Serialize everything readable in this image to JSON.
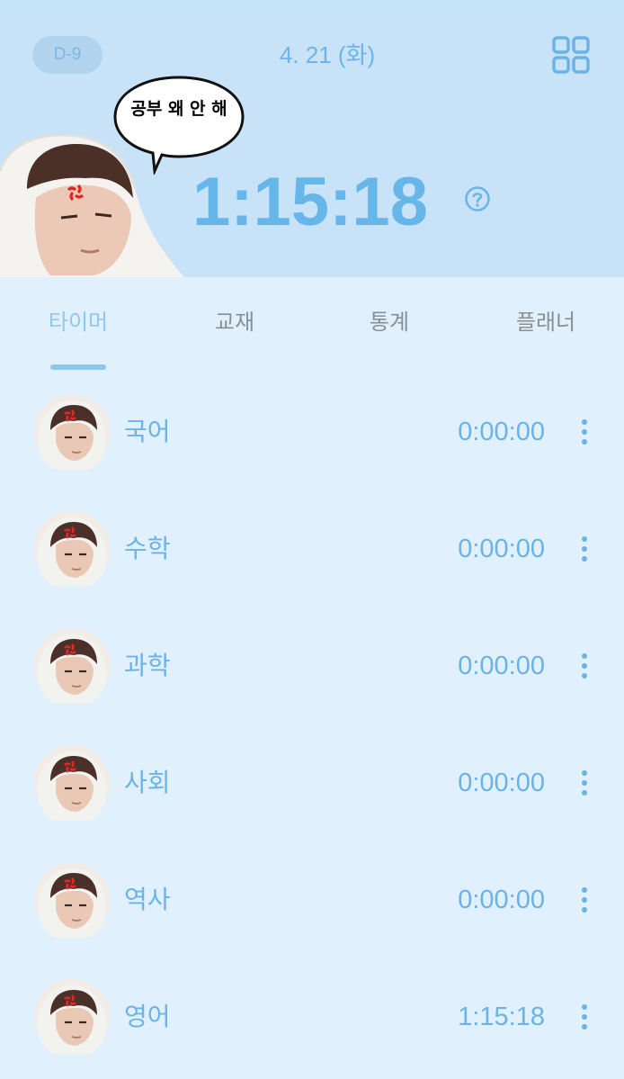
{
  "header": {
    "dday": "D-9",
    "date": "4. 21 (화)",
    "bubble_text": "공부 왜 안 해",
    "timer": "1:15:18"
  },
  "icons": {
    "menu": "grid-icon",
    "help": "help-icon",
    "more": "more-vertical-icon"
  },
  "tabs": [
    {
      "label": "타이머"
    },
    {
      "label": "교재"
    },
    {
      "label": "통계"
    },
    {
      "label": "플래너"
    }
  ],
  "subjects": [
    {
      "name": "국어",
      "time": "0:00:00"
    },
    {
      "name": "수학",
      "time": "0:00:00"
    },
    {
      "name": "과학",
      "time": "0:00:00"
    },
    {
      "name": "사회",
      "time": "0:00:00"
    },
    {
      "name": "역사",
      "time": "0:00:00"
    },
    {
      "name": "영어",
      "time": "1:15:18"
    }
  ],
  "colors": {
    "accent": "#66b6ea",
    "header_bg": "#c8e2f8",
    "body_bg": "#e0f0fc"
  }
}
